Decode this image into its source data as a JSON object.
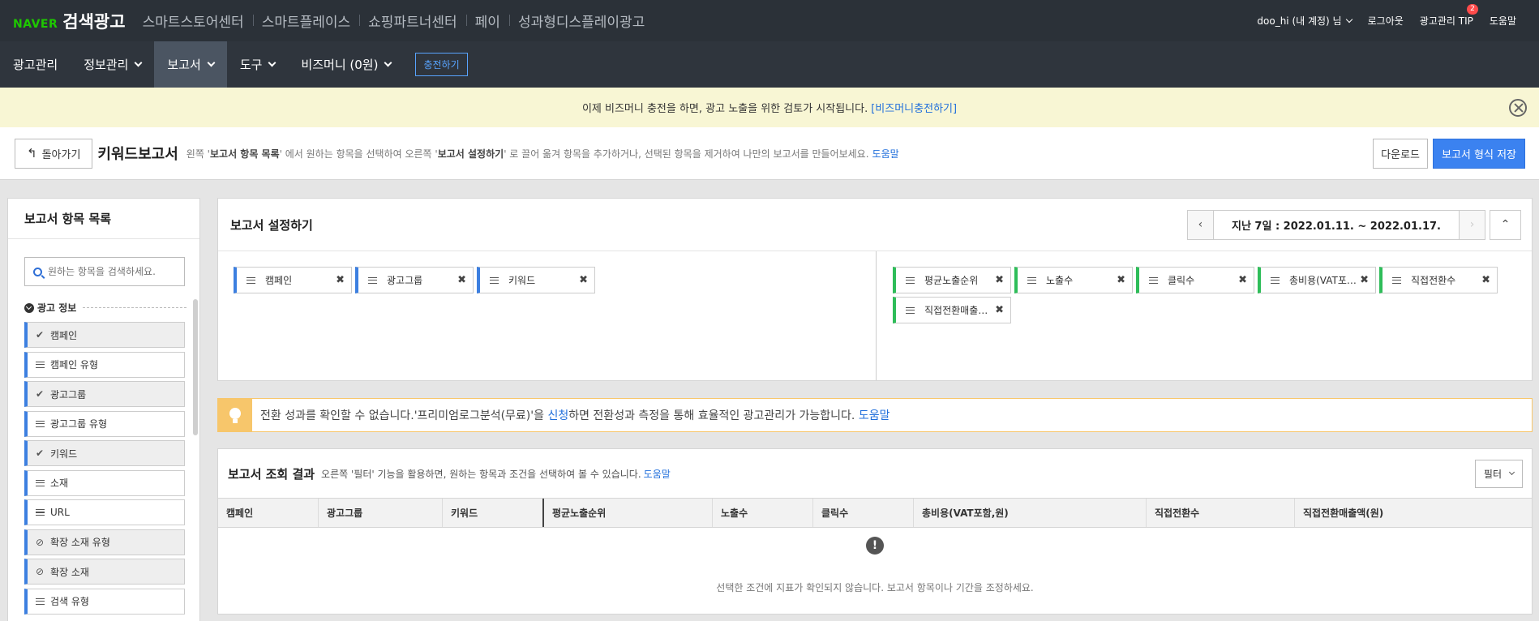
{
  "topbar": {
    "brand": "NAVER",
    "product": "검색광고",
    "sites": [
      "스마트스토어센터",
      "스마트플레이스",
      "쇼핑파트너센터",
      "페이",
      "성과형디스플레이광고"
    ],
    "user": "doo_hi (내 계정) 님",
    "logout": "로그아웃",
    "tip": "광고관리 TIP",
    "tip_badge": "2",
    "help": "도움말"
  },
  "nav": {
    "items": [
      "광고관리",
      "정보관리",
      "보고서",
      "도구",
      "비즈머니 (0원)"
    ],
    "active": "보고서",
    "charge": "충전하기"
  },
  "notice": {
    "text": "이제 비즈머니 충전을 하면, 광고 노출을 위한 검토가 시작됩니다.",
    "link": "[비즈머니충전하기]"
  },
  "header": {
    "back": "돌아가기",
    "title": "키워드보고서",
    "desc_1": "왼쪽 '",
    "desc_b1": "보고서 항목 목록",
    "desc_2": "' 에서 원하는 항목을 선택하여 오른쪽 '",
    "desc_b2": "보고서 설정하기",
    "desc_3": "' 로 끌어 옮겨 항목을 추가하거나, 선택된 항목을 제거하여 나만의 보고서를 만들어보세요.",
    "desc_link": "도움말",
    "download": "다운로드",
    "save": "보고서 형식 저장"
  },
  "left_panel": {
    "title": "보고서 항목 목록",
    "search_placeholder": "원하는 항목을 검색하세요.",
    "section": "광고 정보",
    "items": [
      {
        "label": "캠페인",
        "icon": "check-icon",
        "selected": true
      },
      {
        "label": "캠페인 유형",
        "icon": "drag-handle-icon",
        "selected": false
      },
      {
        "label": "광고그룹",
        "icon": "check-icon",
        "selected": true
      },
      {
        "label": "광고그룹 유형",
        "icon": "drag-handle-icon",
        "selected": false
      },
      {
        "label": "키워드",
        "icon": "check-icon",
        "selected": true
      },
      {
        "label": "소재",
        "icon": "drag-handle-icon",
        "selected": false
      },
      {
        "label": "URL",
        "icon": "drag-handle-icon",
        "selected": false
      },
      {
        "label": "확장 소재 유형",
        "icon": "disabled-icon",
        "selected": false
      },
      {
        "label": "확장 소재",
        "icon": "disabled-icon",
        "selected": false
      },
      {
        "label": "검색 유형",
        "icon": "drag-handle-icon",
        "selected": false
      }
    ]
  },
  "settings": {
    "title": "보고서 설정하기",
    "date_range": "지난 7일 : 2022.01.11. ~ 2022.01.17.",
    "dimensions": [
      "캠페인",
      "광고그룹",
      "키워드"
    ],
    "metrics": [
      "평균노출순위",
      "노출수",
      "클릭수",
      "총비용(VAT포함,원)",
      "직접전환수",
      "직접전환매출액(원)"
    ]
  },
  "tip": {
    "text_1": "전환 성과를 확인할 수 없습니다.'프리미엄로그분석(무료)'을 ",
    "link_apply": "신청",
    "text_2": "하면 전환성과 측정을 통해 효율적인 광고관리가 가능합니다.",
    "link_help": "도움말"
  },
  "results": {
    "title": "보고서 조회 결과",
    "desc": "오른쪽 '필터' 기능을 활용하면, 원하는 항목과 조건을 선택하여 볼 수 있습니다.",
    "desc_link": "도움말",
    "filter": "필터",
    "columns": [
      "캠페인",
      "광고그룹",
      "키워드",
      "평균노출순위",
      "노출수",
      "클릭수",
      "총비용(VAT포함,원)",
      "직접전환수",
      "직접전환매출액(원)"
    ],
    "empty_message": "선택한 조건에 지표가 확인되지 않습니다. 보고서 항목이나 기간을 조정하세요."
  },
  "colors": {
    "brand_green": "#1ec800",
    "accent_blue": "#3b82f0",
    "dimension_blue": "#3c7fe0",
    "metric_green": "#2ebd59",
    "notice_bg": "#f8f6d4",
    "tip_orange": "#f7c66b"
  }
}
